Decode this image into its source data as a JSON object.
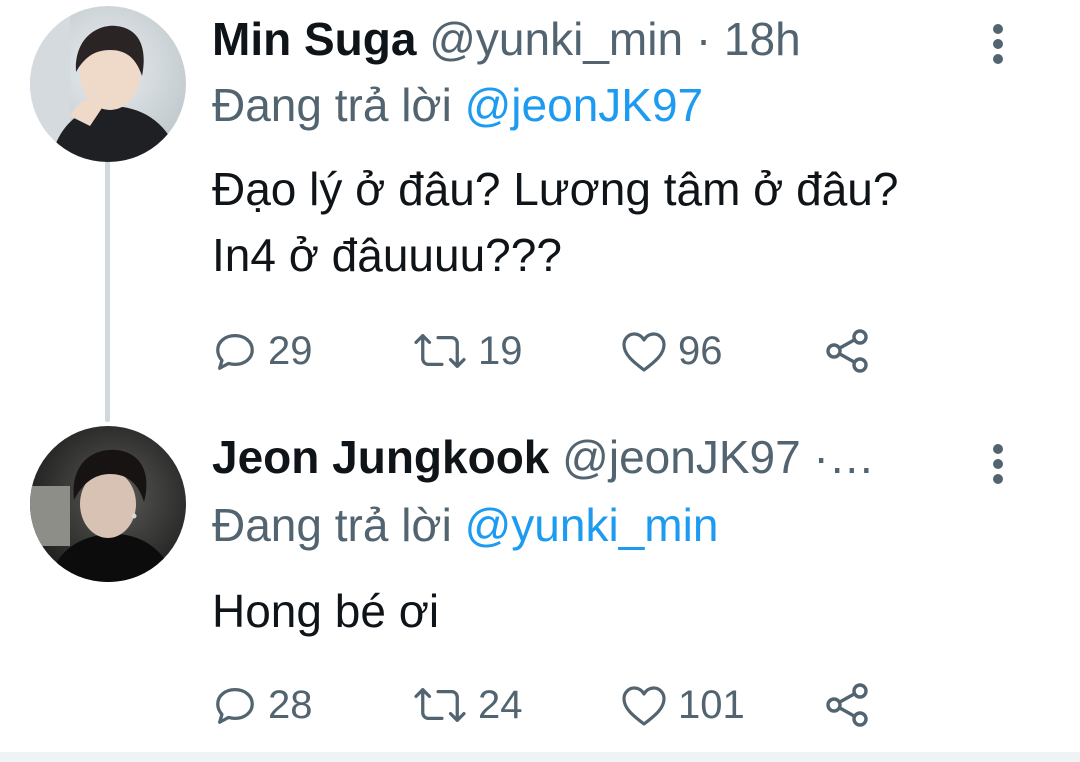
{
  "tweets": [
    {
      "display_name": "Min Suga",
      "handle": "@yunki_min",
      "separator": "·",
      "time": "18h",
      "reply_prefix": "Đang trả lời",
      "reply_to": "@jeonJK97",
      "text": "Đạo lý ở đâu? Lương tâm ở đâu?\nIn4 ở đâuuuu???",
      "counts": {
        "replies": "29",
        "retweets": "19",
        "likes": "96"
      },
      "avatar_icon": "avatar-photo"
    },
    {
      "display_name": "Jeon Jungkook",
      "handle": "@jeonJK97",
      "separator": "·…",
      "time": "",
      "reply_prefix": "Đang trả lời",
      "reply_to": "@yunki_min",
      "text": "Hong bé ơi",
      "counts": {
        "replies": "28",
        "retweets": "24",
        "likes": "101"
      },
      "avatar_icon": "avatar-photo"
    }
  ],
  "icons": {
    "reply": "reply-icon",
    "retweet": "retweet-icon",
    "like": "heart-icon",
    "share": "share-icon",
    "more": "more-vertical-icon"
  },
  "colors": {
    "link": "#1d9bf0",
    "secondary_text": "#536471",
    "primary_text": "#0f1419",
    "thread_line": "#cfd9de"
  }
}
